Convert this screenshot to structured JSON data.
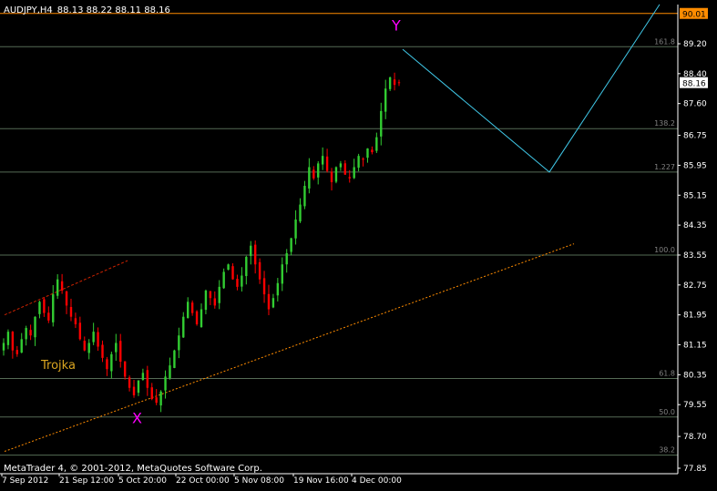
{
  "header": {
    "symbol": "AUDJPY,H4",
    "ohlc": "88.13 88.22 88.11 88.16"
  },
  "footer": {
    "copyright": "MetaTrader 4, © 2001-2012, MetaQuotes Software Corp."
  },
  "colors": {
    "background": "#000000",
    "bull_candle": "#32CD32",
    "bear_candle": "#FF0000",
    "axis": "#FFFFFF",
    "fib_line": "#556B55",
    "fib_label": "#808080",
    "top_level": "#FF8C00",
    "zigzag": "#40C8E8",
    "wave_label": "#FF00FF",
    "trojka_label": "#DAA520",
    "trend_line": "#FF8C00",
    "trend_line_red": "#CC2200"
  },
  "chart_data": {
    "type": "candlestick",
    "y_axis": {
      "ticks": [
        "89.20",
        "88.40",
        "87.60",
        "86.75",
        "85.95",
        "85.15",
        "84.35",
        "83.55",
        "82.75",
        "81.95",
        "81.15",
        "80.35",
        "79.55",
        "78.70",
        "77.85"
      ],
      "min": 77.85,
      "max": 90.4
    },
    "x_axis": {
      "labels": [
        "7 Sep 2012",
        "21 Sep 12:00",
        "5 Oct 20:00",
        "22 Oct 00:00",
        "5 Nov 08:00",
        "19 Nov 16:00",
        "4 Dec 00:00"
      ]
    },
    "price_labels": {
      "top": "90.01",
      "current": "88.16"
    },
    "top_level_price": 90.01,
    "current_price": 88.16,
    "fib_levels": [
      {
        "label": "161.8",
        "price": 89.12
      },
      {
        "label": "138.2",
        "price": 86.93
      },
      {
        "label": "1.227",
        "price": 85.77
      },
      {
        "label": "100.0",
        "price": 83.55
      },
      {
        "label": "61.8",
        "price": 80.25
      },
      {
        "label": "50.0",
        "price": 79.22
      },
      {
        "label": "38.2",
        "price": 78.2
      }
    ],
    "wave_labels": [
      {
        "text": "Y",
        "bar": 430,
        "price": 89.55
      },
      {
        "text": "X",
        "bar": 145,
        "price": 79.05
      }
    ],
    "annotation": {
      "text": "Trojka",
      "bar": 45,
      "price": 80.5
    },
    "zigzag": [
      {
        "bar": 442,
        "price": 89.05
      },
      {
        "bar": 603,
        "price": 85.77
      },
      {
        "bar": 724,
        "price": 90.25
      }
    ],
    "trend_line": [
      {
        "bar": 5,
        "price": 78.3
      },
      {
        "bar": 630,
        "price": 83.85
      }
    ],
    "trend_line_red": [
      {
        "bar": 5,
        "price": 81.95
      },
      {
        "bar": 140,
        "price": 83.4
      }
    ],
    "closes": [
      81.2,
      81.5,
      81.0,
      80.9,
      81.3,
      81.6,
      81.4,
      81.9,
      82.3,
      82.0,
      81.8,
      82.5,
      82.9,
      82.6,
      82.2,
      81.9,
      81.7,
      81.3,
      81.0,
      81.2,
      81.5,
      81.1,
      80.8,
      80.5,
      80.9,
      81.2,
      80.7,
      80.3,
      80.0,
      79.8,
      80.2,
      80.4,
      80.0,
      79.7,
      79.6,
      79.9,
      80.3,
      80.6,
      81.0,
      81.4,
      81.9,
      82.3,
      82.0,
      81.7,
      82.1,
      82.6,
      82.4,
      82.2,
      82.7,
      83.1,
      83.3,
      82.9,
      82.7,
      83.0,
      83.5,
      83.8,
      83.3,
      82.9,
      82.5,
      82.1,
      82.4,
      82.8,
      83.3,
      83.6,
      84.0,
      84.5,
      84.9,
      85.4,
      85.9,
      85.6,
      86.0,
      86.2,
      85.8,
      85.5,
      85.9,
      86.0,
      85.7,
      85.6,
      85.9,
      86.2,
      86.1,
      86.4,
      86.3,
      86.7,
      87.4,
      88.0,
      88.3,
      88.1,
      88.16
    ]
  }
}
